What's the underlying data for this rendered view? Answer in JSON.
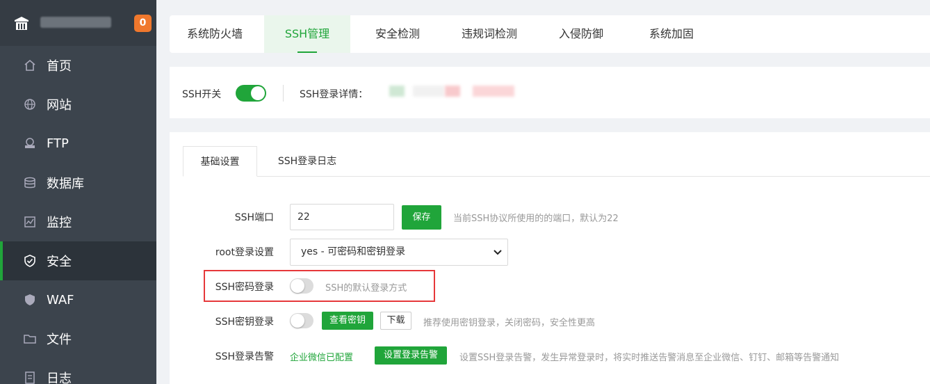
{
  "sidebar": {
    "badge": "0",
    "items": [
      {
        "label": "首页",
        "icon": "home-icon"
      },
      {
        "label": "网站",
        "icon": "globe-icon"
      },
      {
        "label": "FTP",
        "icon": "ftp-icon"
      },
      {
        "label": "数据库",
        "icon": "database-icon"
      },
      {
        "label": "监控",
        "icon": "monitor-icon"
      },
      {
        "label": "安全",
        "icon": "shield-icon",
        "active": true
      },
      {
        "label": "WAF",
        "icon": "waf-shield-icon"
      },
      {
        "label": "文件",
        "icon": "folder-icon"
      },
      {
        "label": "日志",
        "icon": "log-icon"
      }
    ]
  },
  "tabs": [
    "系统防火墙",
    "SSH管理",
    "安全检测",
    "违规词检测",
    "入侵防御",
    "系统加固"
  ],
  "active_tab": "SSH管理",
  "ssh_bar": {
    "switch_label": "SSH开关",
    "switch_on": true,
    "detail_label": "SSH登录详情："
  },
  "subtabs": [
    "基础设置",
    "SSH登录日志"
  ],
  "form": {
    "port_label": "SSH端口",
    "port_value": "22",
    "save_button": "保存",
    "port_hint": "当前SSH协议所使用的的端口，默认为22",
    "root_label": "root登录设置",
    "root_value": "yes - 可密码和密钥登录",
    "password_label": "SSH密码登录",
    "password_hint": "SSH的默认登录方式",
    "key_label": "SSH密钥登录",
    "view_key_button": "查看密钥",
    "download_button": "下载",
    "key_hint": "推荐使用密钥登录，关闭密码，安全性更高",
    "alert_label": "SSH登录告警",
    "alert_status": "企业微信已配置",
    "alert_button": "设置登录告警",
    "alert_hint": "设置SSH登录告警，发生异常登录时，将实时推送告警消息至企业微信、钉钉、邮箱等告警通知"
  },
  "colors": {
    "accent": "#20a53a",
    "sidebar": "#3c444d",
    "highlight": "#e6383a",
    "badge": "#f0782d"
  }
}
